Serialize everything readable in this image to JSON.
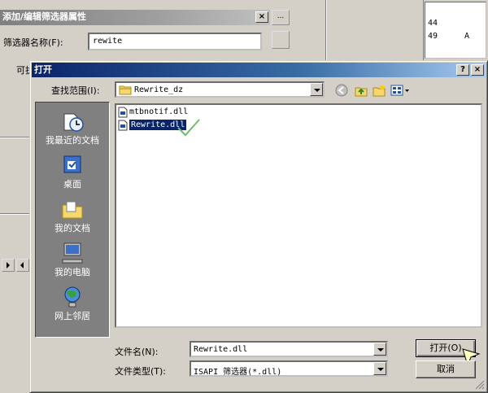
{
  "bg_dialog": {
    "title": "添加/编辑筛选器属性",
    "name_label": "筛选器名称(F):",
    "name_value": "rewite",
    "exec_label": "可执",
    "close_glyph": "×"
  },
  "right_panel": {
    "values": [
      "44",
      "49"
    ],
    "letters": [
      "A"
    ]
  },
  "open_dialog": {
    "title": "打开",
    "help_glyph": "?",
    "close_glyph": "×",
    "look_in_label": "查找范围(I):",
    "look_in_value": "Rewrite_dz",
    "places": [
      {
        "label": "我最近的文档",
        "icon": "recent-documents-icon"
      },
      {
        "label": "桌面",
        "icon": "desktop-icon"
      },
      {
        "label": "我的文档",
        "icon": "my-documents-icon"
      },
      {
        "label": "我的电脑",
        "icon": "my-computer-icon"
      },
      {
        "label": "网上邻居",
        "icon": "network-places-icon"
      }
    ],
    "files": [
      {
        "name": "mtbnotif.dll",
        "selected": false
      },
      {
        "name": "Rewrite.dll",
        "selected": true
      }
    ],
    "file_name_label": "文件名(N):",
    "file_name_value": "Rewrite.dll",
    "file_type_label": "文件类型(T):",
    "file_type_value": "ISAPI 筛选器(*.dll)",
    "open_button": "打开(O)",
    "cancel_button": "取消"
  },
  "colors": {
    "title_active": "#0a246a",
    "title_gradient_end": "#a6caf0",
    "face": "#d4d0c8",
    "places_bar": "#808080",
    "selection": "#0a246a",
    "check_mark": "#6abf69",
    "cursor_yellow": "#ffffc0"
  }
}
